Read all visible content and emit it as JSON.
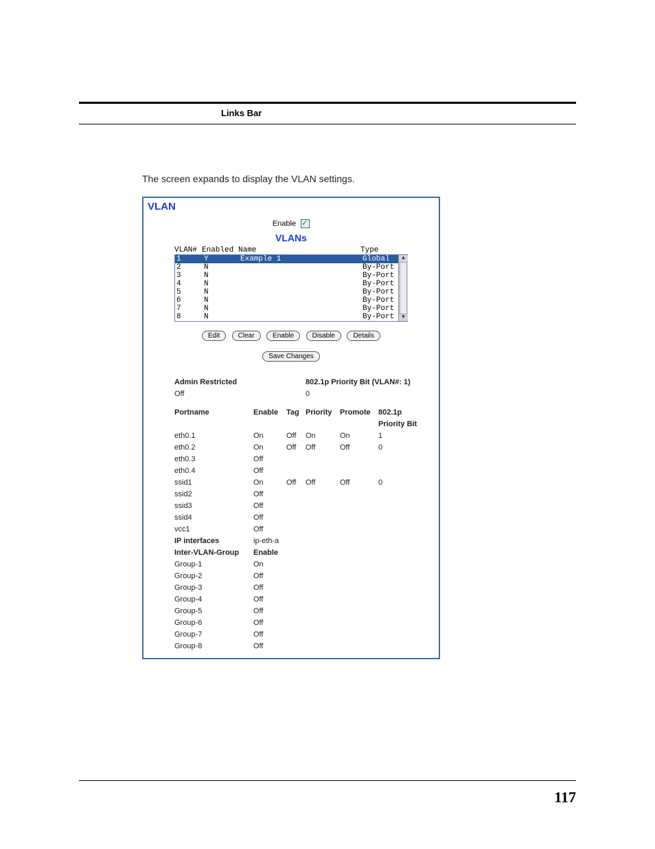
{
  "header": {
    "links_bar": "Links Bar"
  },
  "intro": "The screen expands to display the VLAN settings.",
  "vlan_panel": {
    "title": "VLAN",
    "enable_label": "Enable",
    "vlans_heading": "VLANs",
    "columns": {
      "vlan": "VLAN#",
      "enabled": "Enabled",
      "name": "Name",
      "type": "Type"
    },
    "rows": [
      {
        "n": "1",
        "enabled": "Y",
        "name": "Example 1",
        "type": "Global",
        "selected": true
      },
      {
        "n": "2",
        "enabled": "N",
        "name": "",
        "type": "By-Port"
      },
      {
        "n": "3",
        "enabled": "N",
        "name": "",
        "type": "By-Port"
      },
      {
        "n": "4",
        "enabled": "N",
        "name": "",
        "type": "By-Port"
      },
      {
        "n": "5",
        "enabled": "N",
        "name": "",
        "type": "By-Port"
      },
      {
        "n": "6",
        "enabled": "N",
        "name": "",
        "type": "By-Port"
      },
      {
        "n": "7",
        "enabled": "N",
        "name": "",
        "type": "By-Port"
      },
      {
        "n": "8",
        "enabled": "N",
        "name": "",
        "type": "By-Port"
      }
    ],
    "buttons": {
      "edit": "Edit",
      "clear": "Clear",
      "enable": "Enable",
      "disable": "Disable",
      "details": "Details",
      "save": "Save Changes"
    },
    "admin": {
      "label": "Admin Restricted",
      "value": "Off",
      "priority_label": "802.1p Priority Bit (VLAN#: 1)",
      "priority_value": "0"
    },
    "port_headers": {
      "portname": "Portname",
      "enable": "Enable",
      "tag": "Tag",
      "priority": "Priority",
      "promote": "Promote",
      "pbit": "802.1p Priority Bit"
    },
    "ports": [
      {
        "name": "eth0.1",
        "enable": "On",
        "tag": "Off",
        "priority": "On",
        "promote": "On",
        "pbit": "1"
      },
      {
        "name": "eth0.2",
        "enable": "On",
        "tag": "Off",
        "priority": "Off",
        "promote": "Off",
        "pbit": "0"
      },
      {
        "name": "eth0.3",
        "enable": "Off",
        "tag": "",
        "priority": "",
        "promote": "",
        "pbit": ""
      },
      {
        "name": "eth0.4",
        "enable": "Off",
        "tag": "",
        "priority": "",
        "promote": "",
        "pbit": ""
      },
      {
        "name": "ssid1",
        "enable": "On",
        "tag": "Off",
        "priority": "Off",
        "promote": "Off",
        "pbit": "0"
      },
      {
        "name": "ssid2",
        "enable": "Off",
        "tag": "",
        "priority": "",
        "promote": "",
        "pbit": ""
      },
      {
        "name": "ssid3",
        "enable": "Off",
        "tag": "",
        "priority": "",
        "promote": "",
        "pbit": ""
      },
      {
        "name": "ssid4",
        "enable": "Off",
        "tag": "",
        "priority": "",
        "promote": "",
        "pbit": ""
      },
      {
        "name": "vcc1",
        "enable": "Off",
        "tag": "",
        "priority": "",
        "promote": "",
        "pbit": ""
      }
    ],
    "ip_interfaces": {
      "label": "IP interfaces",
      "value": "ip-eth-a"
    },
    "group_header": {
      "label": "Inter-VLAN-Group",
      "enable": "Enable"
    },
    "groups": [
      {
        "name": "Group-1",
        "enable": "On"
      },
      {
        "name": "Group-2",
        "enable": "Off"
      },
      {
        "name": "Group-3",
        "enable": "Off"
      },
      {
        "name": "Group-4",
        "enable": "Off"
      },
      {
        "name": "Group-5",
        "enable": "Off"
      },
      {
        "name": "Group-6",
        "enable": "Off"
      },
      {
        "name": "Group-7",
        "enable": "Off"
      },
      {
        "name": "Group-8",
        "enable": "Off"
      }
    ]
  },
  "page_number": "117"
}
